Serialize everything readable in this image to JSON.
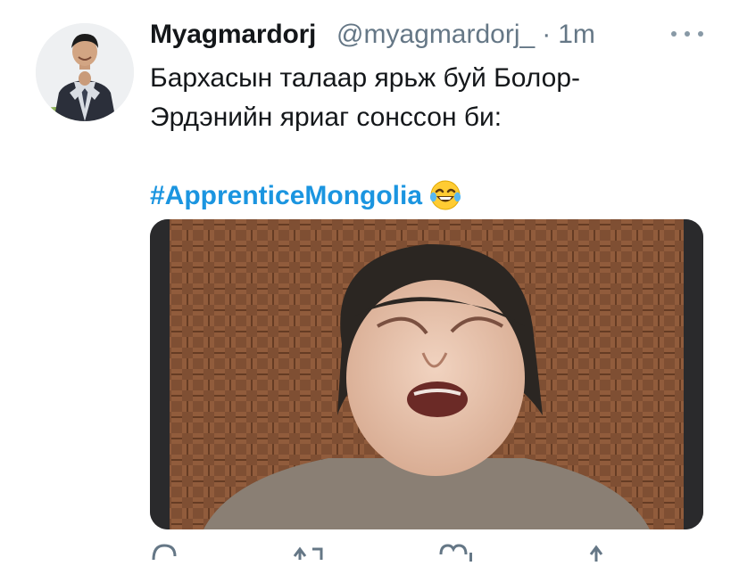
{
  "tweet": {
    "display_name": "Myagmardorj",
    "handle": "@myagmardorj_",
    "separator": "·",
    "time": "1m",
    "text_lines": [
      "Бархасын талаар ярьж буй Болор-",
      "Эрдэнийн яриаг сонссон би:"
    ],
    "hashtag": "#ApprenticeMongolia",
    "emoji": "😂"
  },
  "icons": {
    "more": "more-options-icon",
    "reply": "reply-icon",
    "retweet": "retweet-icon",
    "like": "like-icon",
    "share": "share-icon"
  },
  "colors": {
    "text": "#14171a",
    "secondary": "#657786",
    "link": "#1b95e0"
  }
}
